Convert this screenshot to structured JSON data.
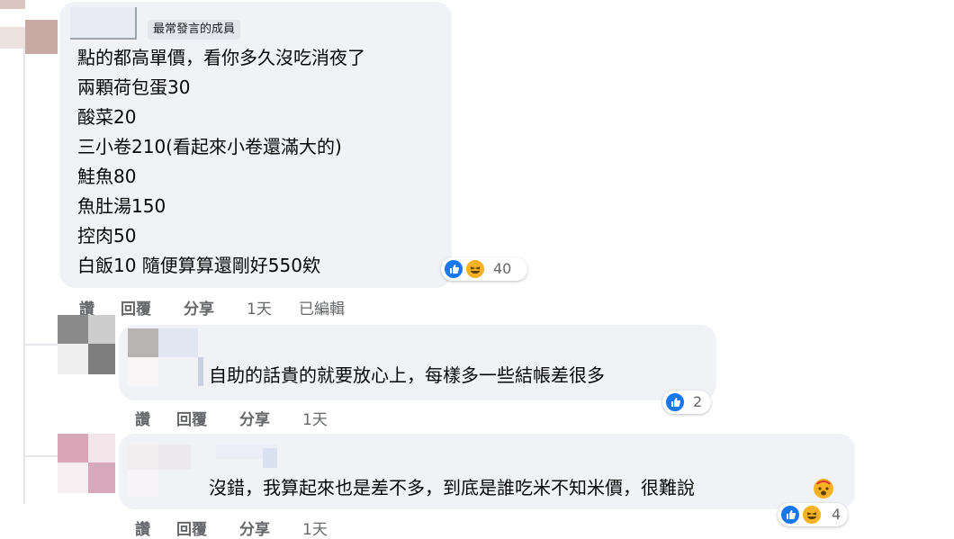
{
  "comment1": {
    "badge": "最常發言的成員",
    "lines": [
      "點的都高單價，看你多久沒吃消夜了",
      "兩顆荷包蛋30",
      "酸菜20",
      "三小卷210(看起來小卷還滿大的)",
      "鮭魚80",
      "魚肚湯150",
      "控肉50",
      "白飯10 隨便算算還剛好550欸"
    ],
    "reaction_count": "40",
    "actions": {
      "like": "讚",
      "reply": "回覆",
      "share": "分享",
      "time": "1天",
      "edited": "已編輯"
    }
  },
  "reply1": {
    "text": "自助的話貴的就要放心上，每樣多一些結帳差很多",
    "reaction_count": "2",
    "actions": {
      "like": "讚",
      "reply": "回覆",
      "share": "分享",
      "time": "1天"
    }
  },
  "reply2": {
    "text": "沒錯，我算起來也是差不多，到底是誰吃米不知米價，很難說",
    "reaction_count": "4",
    "actions": {
      "like": "讚",
      "reply": "回覆",
      "share": "分享",
      "time": "1天"
    }
  },
  "colors": {
    "bubble": "#f0f2f5",
    "like_blue": "#1877f2",
    "haha_yellow": "#f7b125",
    "meta_gray": "#65676b"
  }
}
